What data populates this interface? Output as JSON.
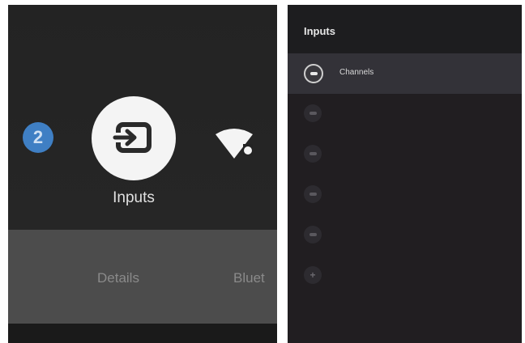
{
  "launcher": {
    "notification_count": "2",
    "tiles": [
      {
        "label": "Inputs",
        "icon": "input-source-icon"
      },
      {
        "label": "",
        "icon": "wifi-icon"
      }
    ],
    "tabs": [
      {
        "label": "Details"
      },
      {
        "label": "Bluet"
      }
    ]
  },
  "inputs_menu": {
    "title": "Inputs",
    "items": [
      {
        "label": "Channels",
        "icon": "input-dash-icon",
        "selected": true
      },
      {
        "label": "",
        "icon": "input-dash-icon",
        "selected": false
      },
      {
        "label": "",
        "icon": "input-dash-icon",
        "selected": false
      },
      {
        "label": "",
        "icon": "input-dash-icon",
        "selected": false
      },
      {
        "label": "",
        "icon": "input-dash-icon",
        "selected": false
      },
      {
        "label": "",
        "icon": "add-icon",
        "selected": false
      }
    ]
  },
  "colors": {
    "badge": "#3f7fc4",
    "launcher_background": "#232323",
    "launcher_bottom_bar": "#4c4c4c",
    "menu_background": "#211e21",
    "menu_selected_row": "#333238"
  }
}
